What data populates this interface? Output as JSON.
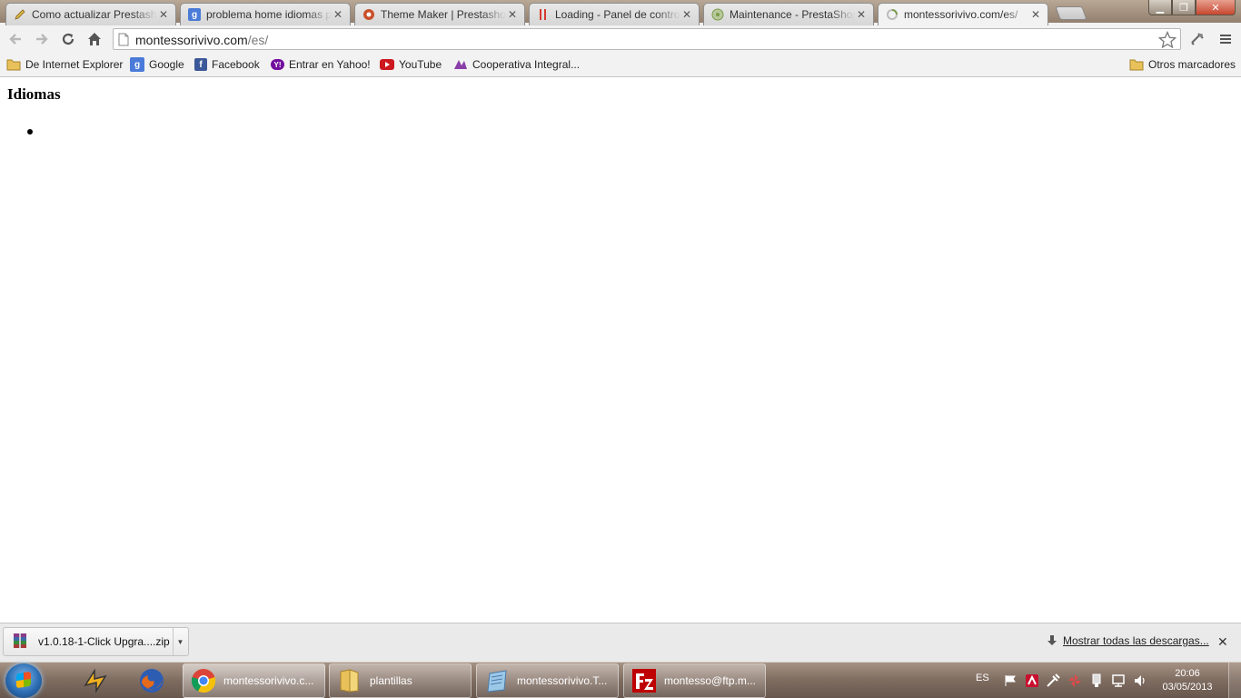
{
  "browser": {
    "tabs": [
      {
        "title": "Como actualizar Prestash",
        "icon": "pencil-icon",
        "color": "#d8b24a"
      },
      {
        "title": "problema home idiomas p",
        "icon": "google-icon",
        "color": "#4a7bd8"
      },
      {
        "title": "Theme Maker | Prestashop",
        "icon": "gear-icon",
        "color": "#c9502a"
      },
      {
        "title": "Loading - Panel de contro",
        "icon": "loading-icon",
        "color": "#d63a2f"
      },
      {
        "title": "Maintenance - PrestaShop",
        "icon": "prestashop-icon",
        "color": "#7a9c4a"
      },
      {
        "title": "montessorivivo.com/es/",
        "icon": "loading-spinner-icon",
        "color": "#cfcfcf"
      }
    ],
    "address": {
      "host": "montessorivivo.com",
      "path": "/es/"
    },
    "bookmarks": [
      {
        "label": "De Internet Explorer",
        "icon": "folder-icon",
        "color": "#e8c15a"
      },
      {
        "label": "Google",
        "icon": "google-icon",
        "color": "#4a7bd8"
      },
      {
        "label": "Facebook",
        "icon": "facebook-icon",
        "color": "#3b5998"
      },
      {
        "label": "Entrar en Yahoo!",
        "icon": "yahoo-icon",
        "color": "#720e9e"
      },
      {
        "label": "YouTube",
        "icon": "youtube-icon",
        "color": "#cc181e"
      },
      {
        "label": "Cooperativa Integral...",
        "icon": "cooperativa-icon",
        "color": "#8a3ea8"
      }
    ],
    "other_bookmarks": "Otros marcadores"
  },
  "page": {
    "heading": "Idiomas",
    "list_items": [
      ""
    ]
  },
  "downloads": {
    "file": "v1.0.18-1-Click Upgra....zip",
    "show_all": "Mostrar todas las descargas..."
  },
  "taskbar": {
    "tasks": [
      {
        "label": "montessorivivo.c...",
        "icon": "chrome-icon"
      },
      {
        "label": "plantillas",
        "icon": "folder-icon"
      },
      {
        "label": "montessorivivo.T...",
        "icon": "notepad-icon"
      },
      {
        "label": "montesso@ftp.m...",
        "icon": "filezilla-icon"
      }
    ],
    "language": "ES",
    "time": "20:06",
    "date": "03/05/2013"
  }
}
